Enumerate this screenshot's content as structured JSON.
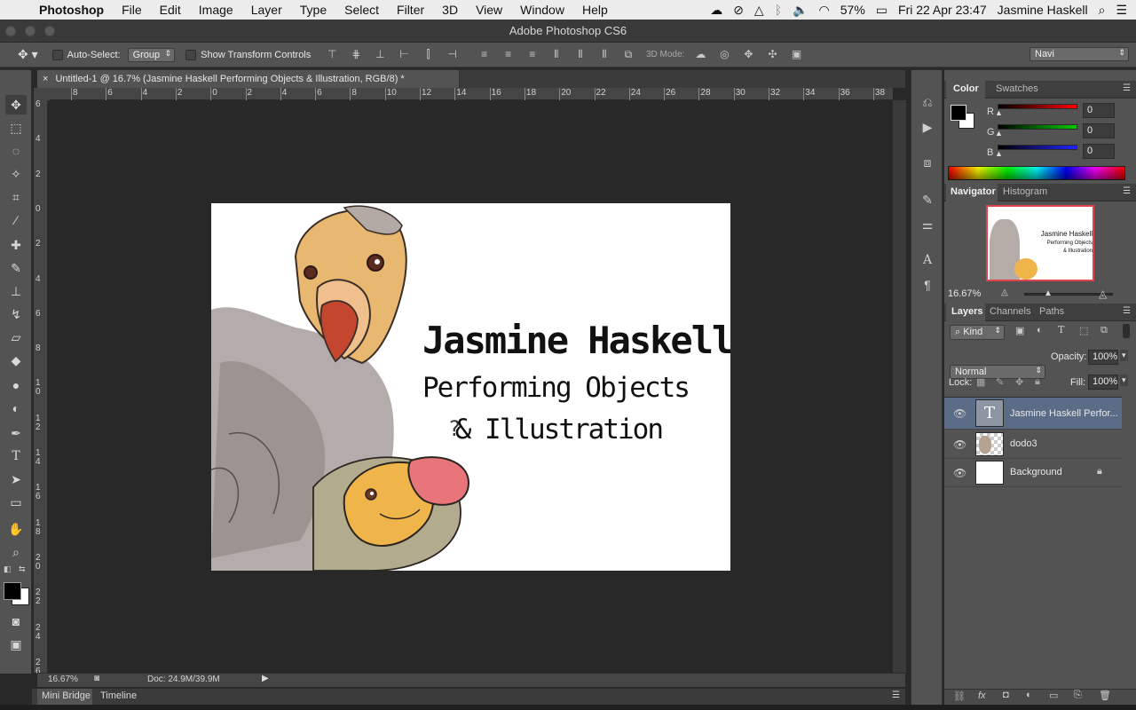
{
  "menubar": {
    "app_name": "Photoshop",
    "items": [
      "File",
      "Edit",
      "Image",
      "Layer",
      "Type",
      "Select",
      "Filter",
      "3D",
      "View",
      "Window",
      "Help"
    ],
    "battery": "57%",
    "datetime": "Fri 22 Apr  23:47",
    "user": "Jasmine Haskell"
  },
  "window": {
    "title": "Adobe Photoshop CS6"
  },
  "options": {
    "auto_select_label": "Auto-Select:",
    "auto_select_value": "Group",
    "transform_controls_label": "Show Transform Controls",
    "mode_3d_label": "3D Mode:",
    "workspace": "Navi"
  },
  "document": {
    "tab_title": "Untitled-1 @ 16.7% (Jasmine Haskell  Performing Objects  & Illustration, RGB/8) *",
    "line1": "Jasmine Haskell",
    "line2": "Performing Objects",
    "line3": "& Illustration",
    "question_mark": "?"
  },
  "rulers": {
    "h_ticks": [
      "8",
      "6",
      "4",
      "2",
      "0",
      "2",
      "4",
      "6",
      "8",
      "10",
      "12",
      "14",
      "16",
      "18",
      "20",
      "22",
      "24",
      "26",
      "28",
      "30",
      "32",
      "34",
      "36",
      "38"
    ],
    "v_ticks": [
      "6",
      "4",
      "2",
      "0",
      "2",
      "4",
      "6",
      "8",
      "10",
      "12",
      "14",
      "16",
      "18",
      "20",
      "22",
      "24",
      "26"
    ]
  },
  "status": {
    "zoom": "16.67%",
    "doc_size": "Doc: 24.9M/39.9M"
  },
  "bottom_tabs": {
    "mini_bridge": "Mini Bridge",
    "timeline": "Timeline"
  },
  "color_panel": {
    "tab_color": "Color",
    "tab_swatches": "Swatches",
    "r_label": "R",
    "g_label": "G",
    "b_label": "B",
    "r_value": "0",
    "g_value": "0",
    "b_value": "0"
  },
  "navigator": {
    "tab_navigator": "Navigator",
    "tab_histogram": "Histogram",
    "zoom": "16.67%",
    "thumb_line1": "Jasmine Haskell",
    "thumb_line2": "Performing Objects",
    "thumb_line3": "& Illustration"
  },
  "layers": {
    "tab_layers": "Layers",
    "tab_channels": "Channels",
    "tab_paths": "Paths",
    "filter_kind": "Kind",
    "blend_mode": "Normal",
    "opacity_label": "Opacity:",
    "opacity_value": "100%",
    "lock_label": "Lock:",
    "fill_label": "Fill:",
    "fill_value": "100%",
    "items": [
      {
        "name": "Jasmine Haskell  Perfor...",
        "type_glyph": "T"
      },
      {
        "name": "dodo3"
      },
      {
        "name": "Background"
      }
    ]
  },
  "colors": {
    "panel": "#535353",
    "selected_layer": "#5a6c86",
    "accent_red": "#e0434b"
  }
}
